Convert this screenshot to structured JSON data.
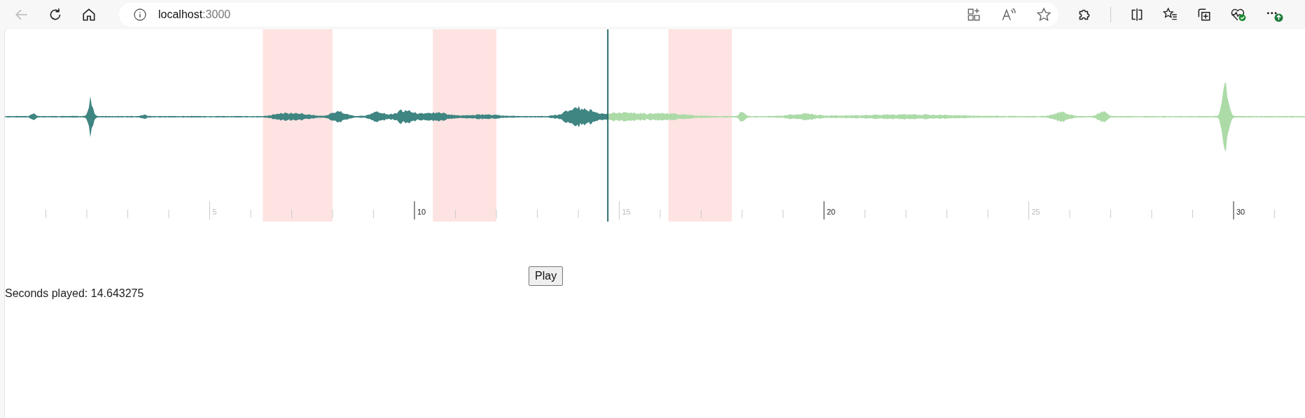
{
  "browser": {
    "url": {
      "host": "localhost",
      "port": ":3000"
    },
    "back_disabled": true
  },
  "waveform": {
    "progress": {
      "level": 0.4635
    },
    "timeline": [
      {
        "label": "5",
        "major": false
      },
      {
        "label": "10",
        "major": true
      },
      {
        "label": "15",
        "major": false
      },
      {
        "label": "20",
        "major": true
      },
      {
        "label": "25",
        "major": false
      },
      {
        "label": "30",
        "major": true
      }
    ]
  },
  "play_button": "Play",
  "status": "Seconds played: 14.643275"
}
